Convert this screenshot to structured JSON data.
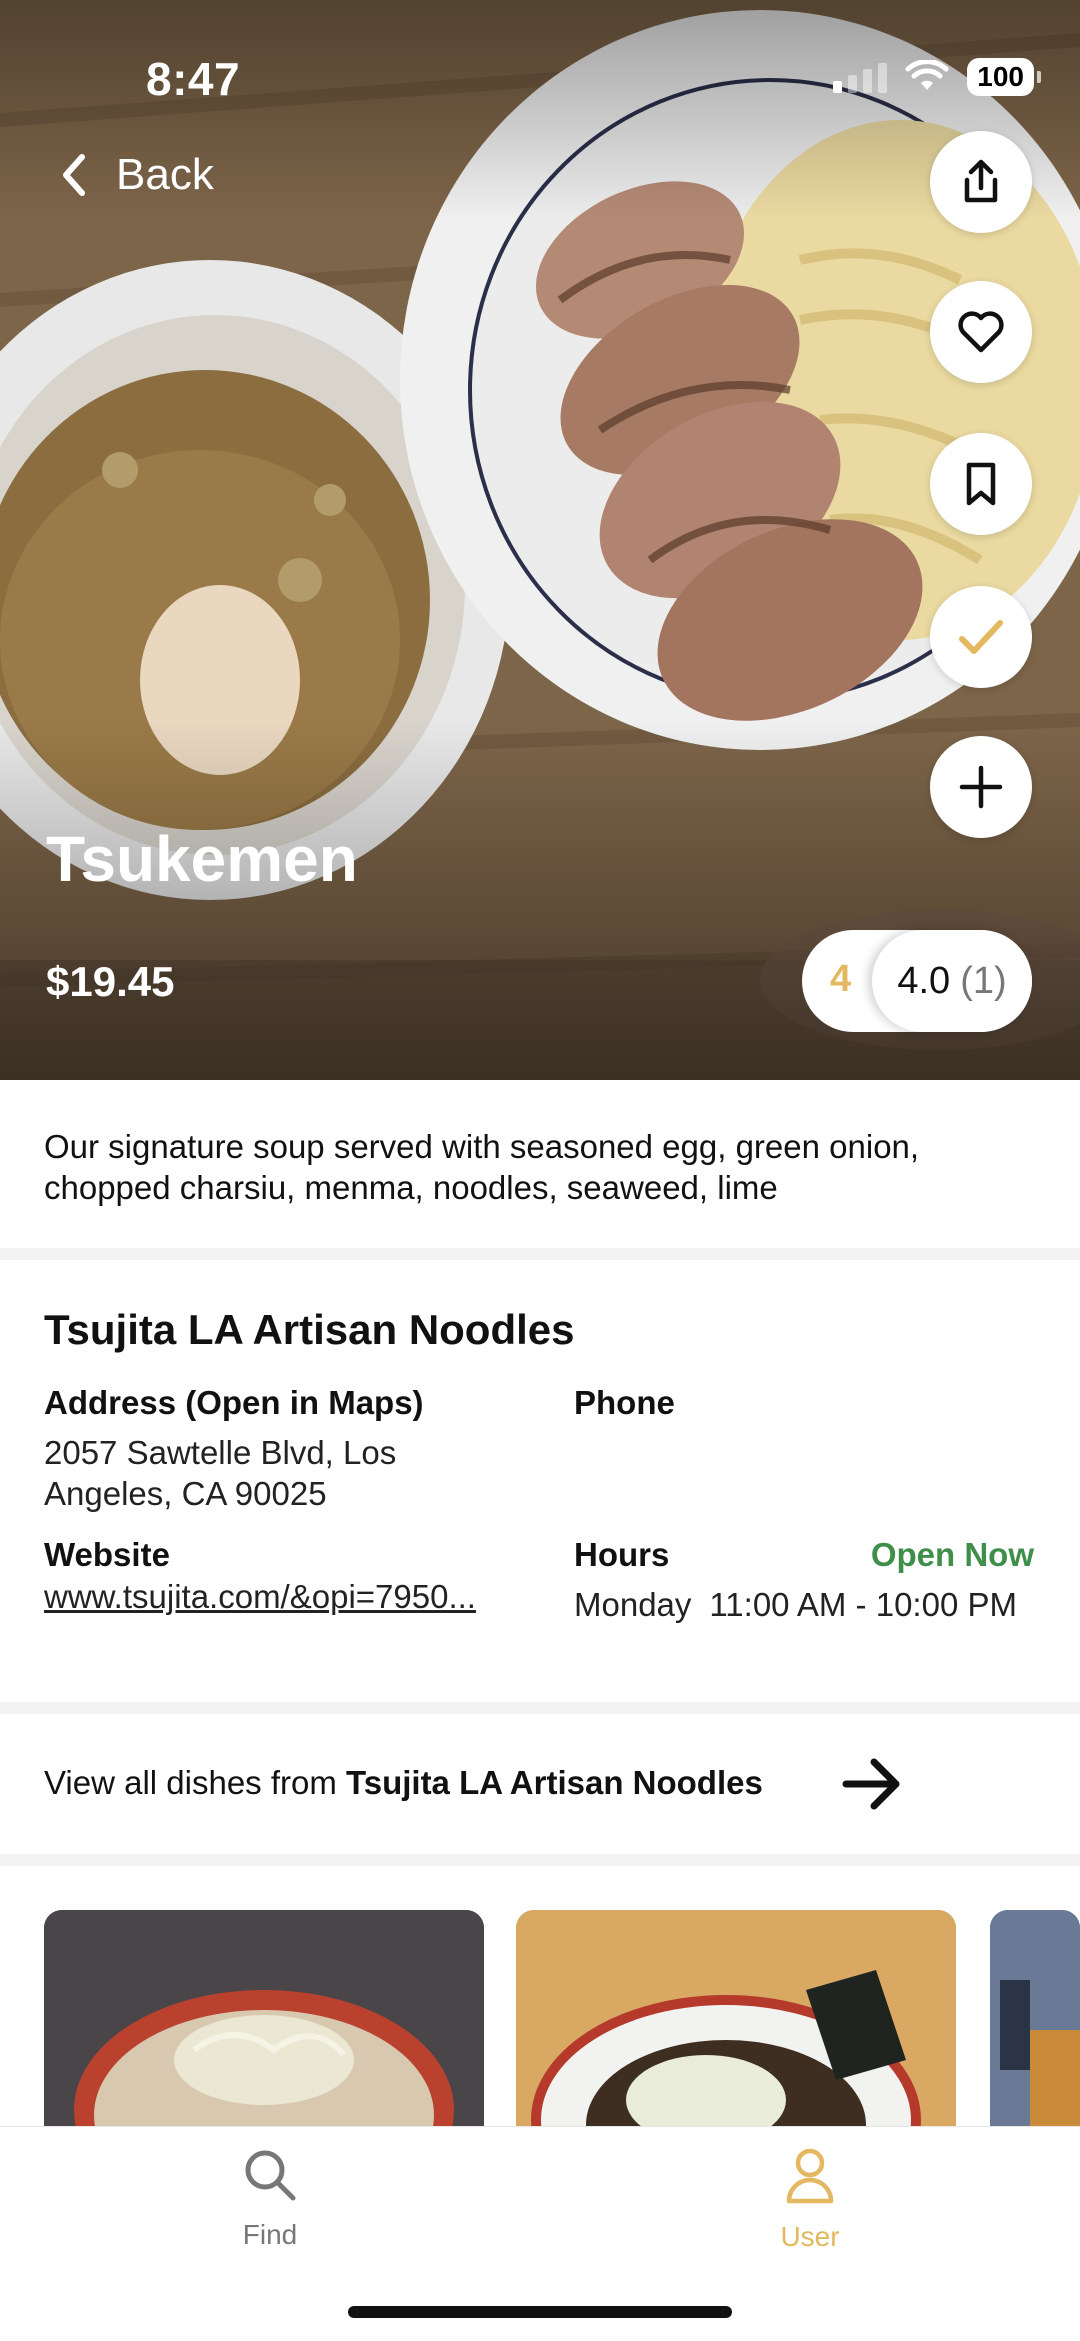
{
  "status_bar": {
    "time": "8:47",
    "battery": "100"
  },
  "nav": {
    "back_label": "Back"
  },
  "hero_actions": [
    "share-icon",
    "heart-icon",
    "bookmark-icon",
    "checkmark-icon",
    "plus-icon"
  ],
  "dish": {
    "name": "Tsukemen",
    "price": "$19.45",
    "my_rating": "4",
    "avg_rating": "4.0",
    "rating_count": "(1)",
    "description": "Our signature soup served with seasoned egg, green onion, chopped charsiu, menma, noodles, seaweed, lime"
  },
  "restaurant": {
    "name": "Tsujita LA Artisan Noodles",
    "address_label": "Address (Open in Maps)",
    "address_line1": "2057 Sawtelle Blvd, Los",
    "address_line2": "Angeles, CA 90025",
    "phone_label": "Phone",
    "website_label": "Website",
    "website": "www.tsujita.com/&opi=7950...",
    "hours_label": "Hours",
    "open_status": "Open Now",
    "hours_day": "Monday",
    "hours_time": "11:00 AM - 10:00 PM"
  },
  "view_all": {
    "prefix": "View all dishes from ",
    "restaurant": "Tsujita LA Artisan Noodles"
  },
  "tabs": [
    {
      "label": "Find",
      "icon": "search-icon"
    },
    {
      "label": "User",
      "icon": "user-icon"
    }
  ],
  "colors": {
    "accent": "#e3b860",
    "open_green": "#3f8f4a",
    "tab_inactive": "#777777"
  }
}
